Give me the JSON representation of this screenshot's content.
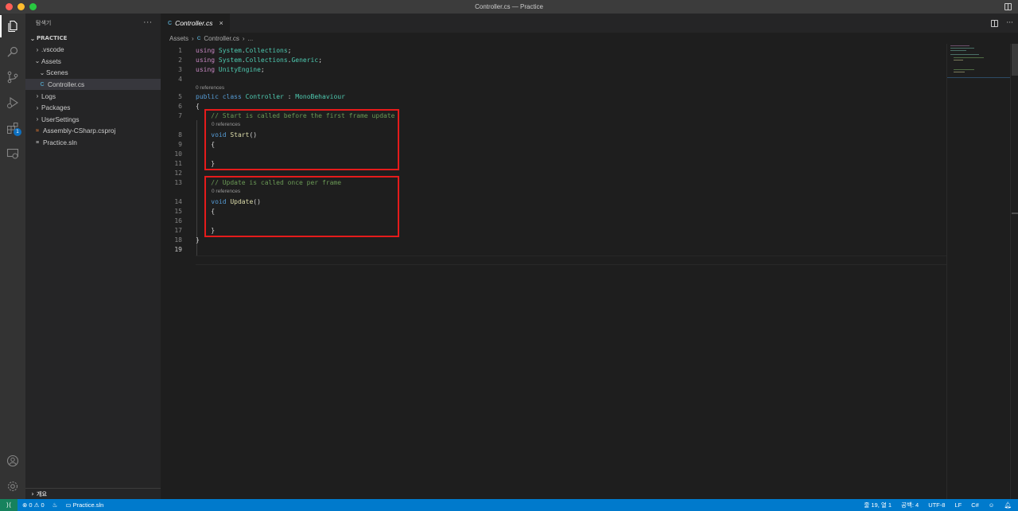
{
  "window": {
    "title": "Controller.cs — Practice"
  },
  "sidebar": {
    "header": "탐색기",
    "more": "···",
    "section": "PRACTICE",
    "items": [
      {
        "label": ".vscode",
        "kind": "folder",
        "expanded": false
      },
      {
        "label": "Assets",
        "kind": "folder",
        "expanded": true
      },
      {
        "label": "Scenes",
        "kind": "folder",
        "expanded": false
      },
      {
        "label": "Controller.cs",
        "kind": "csharp-file",
        "selected": true
      },
      {
        "label": "Logs",
        "kind": "folder",
        "expanded": false
      },
      {
        "label": "Packages",
        "kind": "folder",
        "expanded": false
      },
      {
        "label": "UserSettings",
        "kind": "folder",
        "expanded": false
      },
      {
        "label": "Assembly-CSharp.csproj",
        "kind": "rss-file"
      },
      {
        "label": "Practice.sln",
        "kind": "sln-file"
      }
    ],
    "outline_label": "개요"
  },
  "activity": {
    "extensions_badge": "1"
  },
  "editor": {
    "tab": {
      "label": "Controller.cs",
      "icon_text": "C#",
      "close": "×"
    },
    "actions_more": "···",
    "breadcrumb": {
      "folder": "Assets",
      "file": "Controller.cs",
      "trail": "..."
    },
    "codelens": "0 references",
    "line_numbers": [
      "1",
      "2",
      "3",
      "4",
      "5",
      "6",
      "7",
      "8",
      "9",
      "10",
      "11",
      "12",
      "13",
      "14",
      "15",
      "16",
      "17",
      "18",
      "19"
    ]
  },
  "statusbar": {
    "errors": "0",
    "warnings": "0",
    "solution": "Practice.sln",
    "position": "줄 19, 열 1",
    "spaces": "공백: 4",
    "encoding": "UTF-8",
    "eol": "LF",
    "language": "C#"
  },
  "colors": {
    "accent": "#007acc",
    "highlight_box": "#e51b1b",
    "remote": "#16825d"
  }
}
